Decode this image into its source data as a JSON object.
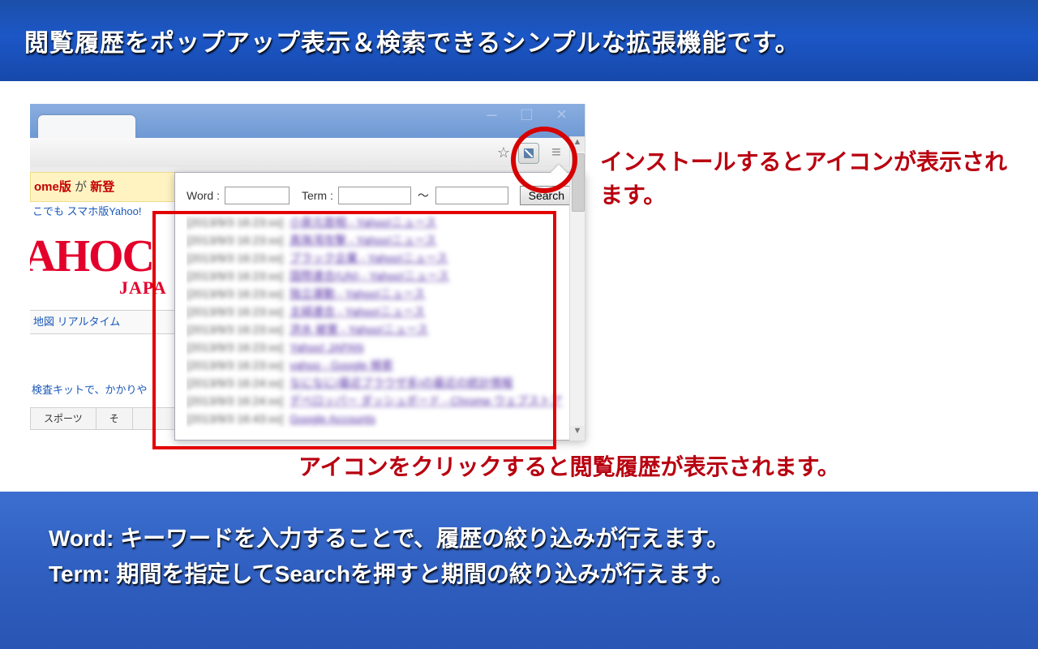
{
  "top_banner": "閲覧履歴をポップアップ表示＆検索できるシンプルな拡張機能です。",
  "browser": {
    "promo_prefix": "ome版",
    "promo_middle": "が",
    "promo_bold": "新登",
    "subpromo": "こでも スマホ版Yahoo!",
    "logo": "AHOC",
    "logo_sub": "JAPA",
    "tabs": "地図  リアルタイム",
    "midtxt": "検査キットで、かかりや",
    "bottab_a": "スポーツ",
    "bottab_b": "そ"
  },
  "popup": {
    "word_label": "Word :",
    "term_label": "Term :",
    "tilde": "〜",
    "search_button": "Search",
    "word_value": "",
    "term_from": "",
    "term_to": "",
    "history": [
      {
        "date": "2013/9/3 16:23:xx",
        "title": "小泉元首相 - Yahoo!ニュース"
      },
      {
        "date": "2013/9/3 16:23:xx",
        "title": "真珠湾攻撃 - Yahoo!ニュース"
      },
      {
        "date": "2013/9/3 16:23:xx",
        "title": "ブラック企業 - Yahoo!ニュース"
      },
      {
        "date": "2013/9/3 16:23:xx",
        "title": "国際連合(UN) - Yahoo!ニュース"
      },
      {
        "date": "2013/9/3 16:23:xx",
        "title": "独立運動 - Yahoo!ニュース"
      },
      {
        "date": "2013/9/3 16:23:xx",
        "title": "主婦連合 - Yahoo!ニュース"
      },
      {
        "date": "2013/9/3 16:23:xx",
        "title": "洪水 被害 - Yahoo!ニュース"
      },
      {
        "date": "2013/9/3 16:23:xx",
        "title": "Yahoo! JAPAN"
      },
      {
        "date": "2013/9/3 16:23:xx",
        "title": "yahoo - Google 検索"
      },
      {
        "date": "2013/9/3 16:24:xx",
        "title": "なになに(最近ブラウザ系)の最近の統計情報"
      },
      {
        "date": "2013/9/3 16:24:xx",
        "title": "デベロッパー ダッシュボード - Chrome ウェブストア"
      },
      {
        "date": "2013/9/3 16:43:xx",
        "title": "Google Accounts"
      }
    ]
  },
  "annotation_right": "インストールするとアイコンが表示されます。",
  "annotation_bottom": "アイコンをクリックすると閲覧履歴が表示されます。",
  "bottom_banner": {
    "line1": "Word: キーワードを入力することで、履歴の絞り込みが行えます。",
    "line2": "Term: 期間を指定してSearchを押すと期間の絞り込みが行えます。"
  }
}
